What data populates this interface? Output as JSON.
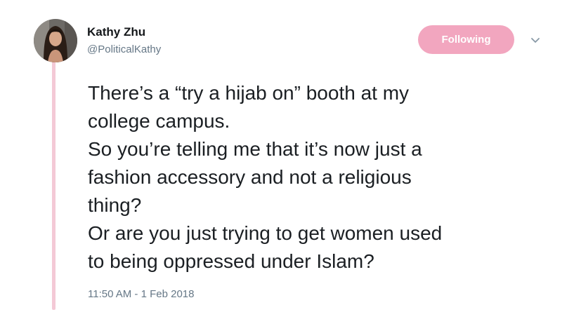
{
  "author": {
    "display_name": "Kathy Zhu",
    "handle": "@PoliticalKathy",
    "avatar_icon": "profile-photo"
  },
  "follow_button": {
    "label": "Following",
    "color": "#f2a6bf"
  },
  "menu": {
    "icon": "chevron-down-icon"
  },
  "tweet": {
    "lines": [
      "There’s a “try a hijab on” booth at my",
      "college campus.",
      "So you’re telling me that it’s now just a",
      "fashion accessory and not a religious",
      "thing?",
      "Or are you just trying to get women used",
      "to being oppressed under Islam?"
    ],
    "timestamp": "11:50 AM - 1 Feb 2018"
  },
  "colors": {
    "thread_line": "#f4c9d6",
    "text": "#1b1f23",
    "muted": "#657786"
  }
}
